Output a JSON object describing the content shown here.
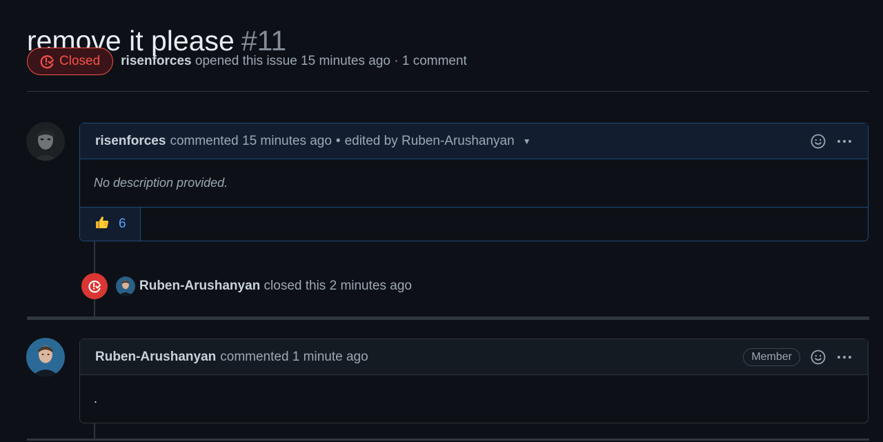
{
  "issue": {
    "title": "remove it please",
    "number": "#11",
    "state": "Closed",
    "author": "risenforces",
    "meta_text": "opened this issue 15 minutes ago · 1 comment"
  },
  "comments": [
    {
      "author": "risenforces",
      "time_text": "commented 15 minutes ago",
      "edited_text": "edited by Ruben-Arushanyan",
      "body": "No description provided.",
      "reaction_count": "6"
    },
    {
      "author": "Ruben-Arushanyan",
      "time_text": "commented 1 minute ago",
      "badge": "Member",
      "body": "."
    }
  ],
  "event": {
    "actor": "Ruben-Arushanyan",
    "action": "closed this",
    "time": "2 minutes ago"
  },
  "icons": {
    "state": "issue-closed-icon",
    "emoji": "smiley-icon",
    "more": "kebab-horizontal-icon",
    "reaction": "thumbs-up-emoji"
  },
  "colors": {
    "background": "#0d1117",
    "closed_red": "#f85149",
    "closed_fill": "#da3633",
    "accent_blue": "#58a6ff",
    "border": "#30363d"
  }
}
